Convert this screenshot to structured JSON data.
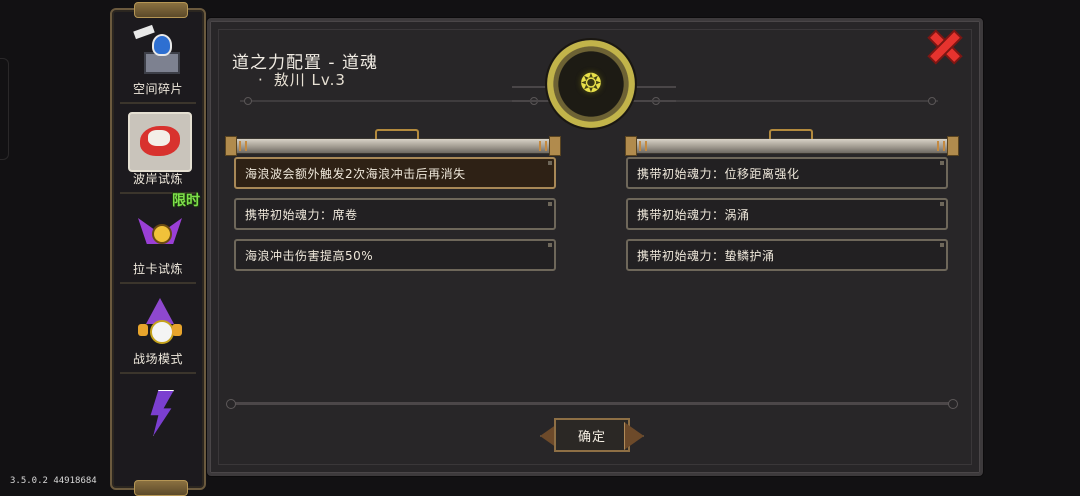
{
  "panel": {
    "title": "道之力配置 - 道魂",
    "subtitle_dot": "·",
    "subtitle": "敖川 Lv.3",
    "confirm_label": "确定",
    "close_icon": "close-x-icon",
    "emblem_icon": "dragon-soul-emblem-icon"
  },
  "left_options": [
    {
      "text": "海浪波会额外触发2次海浪冲击后再消失",
      "selected": true
    },
    {
      "text": "携带初始魂力：席卷",
      "selected": false
    },
    {
      "text": "海浪冲击伤害提高50%",
      "selected": false
    }
  ],
  "right_options": [
    {
      "text": "携带初始魂力：位移距离强化",
      "selected": false
    },
    {
      "text": "携带初始魂力：涡涌",
      "selected": false
    },
    {
      "text": "携带初始魂力：蛰鳞护涌",
      "selected": false
    }
  ],
  "sidebar": {
    "items": [
      {
        "label": "空间碎片",
        "icon": "space-fragment-icon"
      },
      {
        "label": "波岸试炼",
        "icon": "wave-trial-icon",
        "active": true
      },
      {
        "label": "拉卡试炼",
        "icon": "laka-trial-icon",
        "tag": "限时"
      },
      {
        "label": "战场模式",
        "icon": "battlefield-icon"
      },
      {
        "label": "",
        "icon": "lightning-icon"
      }
    ]
  },
  "footer": {
    "version": "3.5.0.2 44918684"
  },
  "colors": {
    "panel_bg": "#282628",
    "accent_gold": "#a88857",
    "close_red": "#e6332e",
    "limited_green": "#7ee04a"
  }
}
